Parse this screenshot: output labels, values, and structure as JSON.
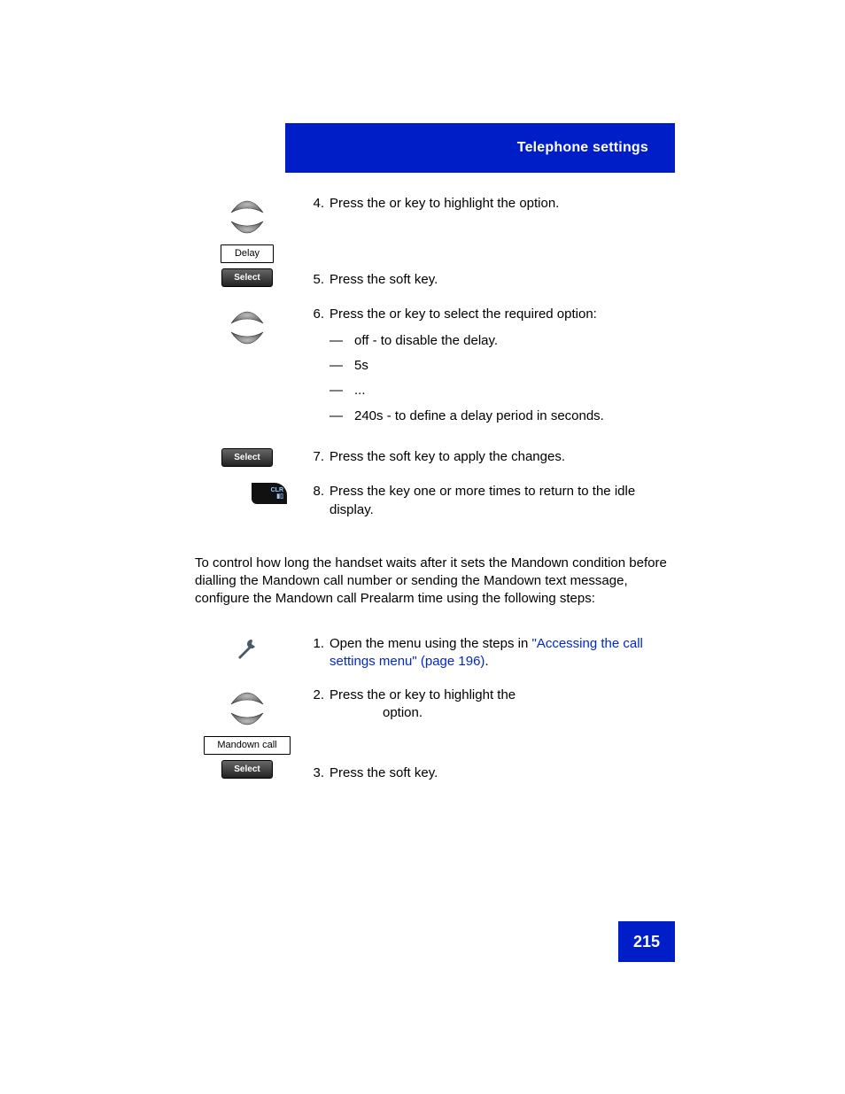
{
  "header": {
    "title": "Telephone settings"
  },
  "steps1": {
    "s4": {
      "num": "4.",
      "pre": "Press the ",
      "mid": " or ",
      "post": " key to highlight the ",
      "tail": " option.",
      "btn": "Delay",
      "soft": "Select"
    },
    "s5": {
      "num": "5.",
      "pre": "Press the ",
      "tail": " soft key."
    },
    "s6": {
      "num": "6.",
      "pre": "Press the ",
      "mid": " or ",
      "post": " key to select the required option:",
      "items": [
        "off - to disable the delay.",
        "5s",
        "...",
        "240s - to define a delay period in seconds."
      ],
      "soft": "Select"
    },
    "s7": {
      "num": "7.",
      "pre": "Press the ",
      "tail": " soft key to apply the changes."
    },
    "s8": {
      "num": "8.",
      "pre": "Press the ",
      "tail": " key one or more times to return to the idle display."
    }
  },
  "para": "To control how long the handset waits after it sets the Mandown condition before dialling the Mandown call number or sending the Mandown text message, configure the Mandown call Prealarm time using the following steps:",
  "steps2": {
    "s1": {
      "num": "1.",
      "pre": "Open the ",
      "mid": " menu using the steps in ",
      "link": "\"Accessing the call settings menu\" (page 196)",
      "tail": "."
    },
    "s2": {
      "num": "2.",
      "pre": "Press the ",
      "mid": " or ",
      "post": " key to highlight the ",
      "tail": " option.",
      "btn": "Mandown call",
      "soft": "Select"
    },
    "s3": {
      "num": "3.",
      "pre": "Press the ",
      "tail": " soft key."
    }
  },
  "dash": "—",
  "pageNumber": "215"
}
